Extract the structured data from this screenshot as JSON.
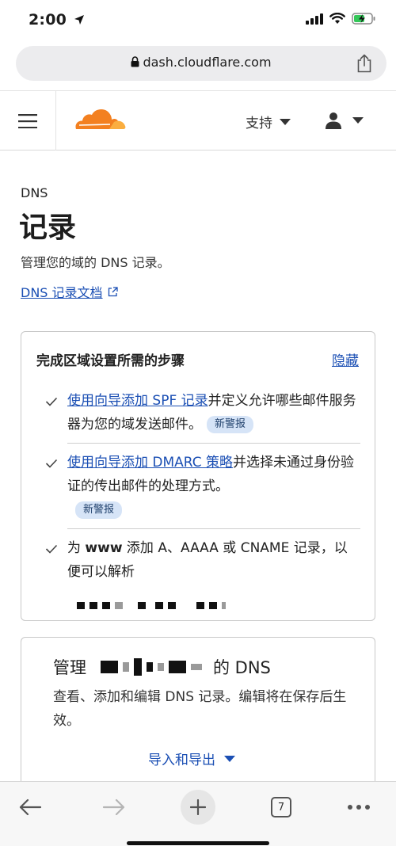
{
  "status": {
    "time": "2:00"
  },
  "browser": {
    "url": "dash.cloudflare.com",
    "open_tabs": "7"
  },
  "header": {
    "support_label": "支持"
  },
  "page": {
    "breadcrumb": "DNS",
    "title": "记录",
    "description": "管理您的域的 DNS 记录。",
    "docs_link": "DNS 记录文档"
  },
  "setup_card": {
    "title": "完成区域设置所需的步骤",
    "hide_label": "隐藏",
    "steps": [
      {
        "link": "使用向导添加 SPF 记录",
        "text": "并定义允许哪些邮件服务器为您的域发送邮件。",
        "badge": "新警报"
      },
      {
        "link": "使用向导添加 DMARC 策略",
        "text": "并选择未通过身份验证的传出邮件的处理方式。",
        "badge": "新警报"
      },
      {
        "prefix": "为 ",
        "bold": "www",
        "text": " 添加 A、AAAA 或 CNAME 记录，以便可以解析"
      }
    ]
  },
  "manage_card": {
    "title_prefix": "管理",
    "title_suffix": "的 DNS",
    "description": "查看、添加和编辑 DNS 记录。编辑将在保存后生效。",
    "import_export": "导入和导出"
  },
  "colors": {
    "link": "#1b4fb4",
    "cloudflare_orange": "#f38020",
    "badge_bg": "#d6e4f7"
  }
}
